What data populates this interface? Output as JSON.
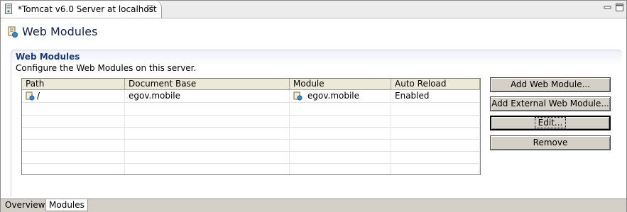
{
  "editor": {
    "tab_title": "*Tomcat v6.0 Server at localhost",
    "close_glyph": "☒"
  },
  "page": {
    "title": "Web Modules"
  },
  "section": {
    "title": "Web Modules",
    "description": "Configure the Web Modules on this server."
  },
  "table": {
    "columns": [
      "Path",
      "Document Base",
      "Module",
      "Auto Reload"
    ],
    "rows": [
      {
        "path": "/",
        "document_base": "egov.mobile",
        "module": "egov.mobile",
        "auto_reload": "Enabled"
      }
    ]
  },
  "buttons": {
    "add_web_module": "Add Web Module...",
    "add_external_web_module": "Add External Web Module...",
    "edit": "Edit...",
    "remove": "Remove"
  },
  "bottom_tabs": [
    "Overview",
    "Modules"
  ],
  "active_bottom_tab": "Modules",
  "colors": {
    "section_title": "#1f3a7a",
    "page_title": "#111f44"
  }
}
